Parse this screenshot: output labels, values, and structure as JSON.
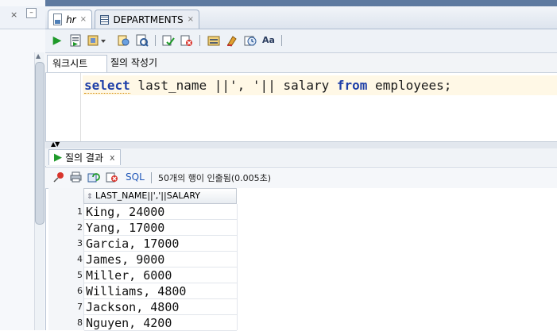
{
  "left_panel": {
    "close_glyph": "×",
    "minimize_glyph": "–"
  },
  "tabs": [
    {
      "label": "hr",
      "icon": "sql-worksheet-icon",
      "active": true
    },
    {
      "label": "DEPARTMENTS",
      "icon": "table-grid-icon",
      "active": false
    }
  ],
  "tab_close_glyph": "×",
  "toolbar_icons": [
    "run-statement-icon",
    "run-script-icon",
    "explain-plan-icon",
    "autotrace-icon",
    "sql-tuning-icon",
    "commit-icon",
    "rollback-icon",
    "unshared-sql-icon",
    "clear-icon",
    "history-icon",
    "format-case-icon"
  ],
  "worksheet_tabs": {
    "worksheet": "워크시트",
    "query_builder": "질의 작성기"
  },
  "editor": {
    "tokens": [
      {
        "text": "select",
        "kind": "keyword"
      },
      {
        "text": " last_name ||', '|| salary ",
        "kind": "plain"
      },
      {
        "text": "from",
        "kind": "keyword"
      },
      {
        "text": " employees;",
        "kind": "plain"
      }
    ]
  },
  "results": {
    "tab_label": "질의 결과",
    "tab_close": "x",
    "sql_link": "SQL",
    "status": "50개의 행이 인출됨(0.005초)",
    "column_header": "LAST_NAME||','||SALARY",
    "rows": [
      {
        "n": "1",
        "value": "King, 24000"
      },
      {
        "n": "2",
        "value": "Yang, 17000"
      },
      {
        "n": "3",
        "value": "Garcia, 17000"
      },
      {
        "n": "4",
        "value": "James, 9000"
      },
      {
        "n": "5",
        "value": "Miller, 6000"
      },
      {
        "n": "6",
        "value": "Williams, 4800"
      },
      {
        "n": "7",
        "value": "Jackson, 4800"
      },
      {
        "n": "8",
        "value": "Nguyen, 4200"
      }
    ]
  },
  "colors": {
    "keyword": "#1e3fa8",
    "link": "#1f56b8",
    "current_line": "#fff8e6",
    "top_band": "#5e7aa0"
  }
}
